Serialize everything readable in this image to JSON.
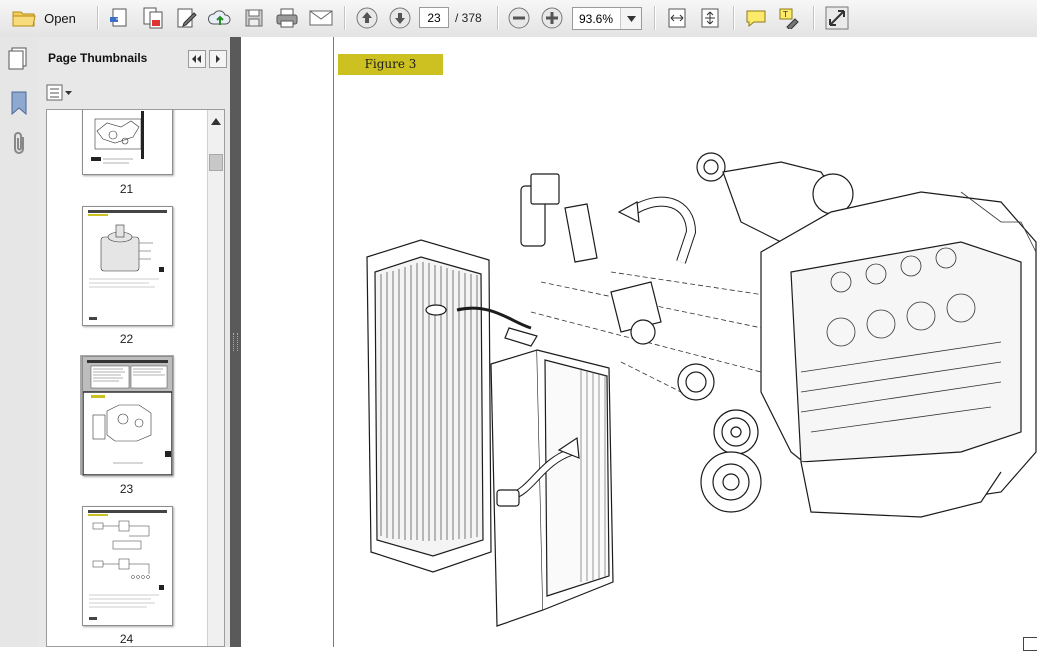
{
  "toolbar": {
    "open_label": "Open",
    "current_page": "23",
    "page_total": "/ 378",
    "zoom_value": "93.6%"
  },
  "sidebar": {
    "title": "Page Thumbnails",
    "thumbnails": [
      {
        "page": "21",
        "selected": false
      },
      {
        "page": "22",
        "selected": false
      },
      {
        "page": "23",
        "selected": true
      },
      {
        "page": "24",
        "selected": false
      }
    ]
  },
  "document": {
    "figure_label": "Figure 3"
  },
  "colors": {
    "figure_label_bg": "#cdc122",
    "selected_thumb_bg": "#a9a9a9"
  }
}
